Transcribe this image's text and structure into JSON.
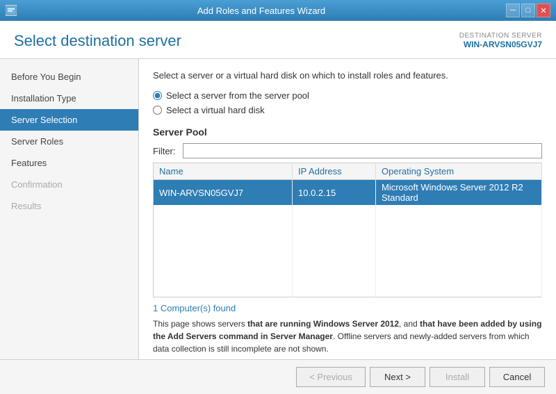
{
  "titleBar": {
    "title": "Add Roles and Features Wizard",
    "icon": "wizard-icon",
    "minButton": "─",
    "maxButton": "□",
    "closeButton": "✕"
  },
  "header": {
    "title": "Select destination server",
    "destinationLabel": "DESTINATION SERVER",
    "serverName": "WIN-ARVSN05GVJ7"
  },
  "sidebar": {
    "items": [
      {
        "label": "Before You Begin",
        "state": "normal"
      },
      {
        "label": "Installation Type",
        "state": "normal"
      },
      {
        "label": "Server Selection",
        "state": "active"
      },
      {
        "label": "Server Roles",
        "state": "normal"
      },
      {
        "label": "Features",
        "state": "normal"
      },
      {
        "label": "Confirmation",
        "state": "disabled"
      },
      {
        "label": "Results",
        "state": "disabled"
      }
    ]
  },
  "content": {
    "description": "Select a server or a virtual hard disk on which to install roles and features.",
    "radio1": "Select a server from the server pool",
    "radio2": "Select a virtual hard disk",
    "sectionTitle": "Server Pool",
    "filterLabel": "Filter:",
    "filterPlaceholder": "",
    "tableColumns": {
      "name": "Name",
      "ipAddress": "IP Address",
      "operatingSystem": "Operating System"
    },
    "tableRows": [
      {
        "name": "WIN-ARVSN05GVJ7",
        "ipAddress": "10.0.2.15",
        "operatingSystem": "Microsoft Windows Server 2012 R2 Standard",
        "selected": true
      }
    ],
    "foundCount": "1 Computer(s) found",
    "infoText": "This page shows servers that are running Windows Server 2012, and that have been added by using the Add Servers command in Server Manager. Offline servers and newly-added servers from which data collection is still incomplete are not shown."
  },
  "footer": {
    "previousLabel": "< Previous",
    "nextLabel": "Next >",
    "installLabel": "Install",
    "cancelLabel": "Cancel"
  }
}
